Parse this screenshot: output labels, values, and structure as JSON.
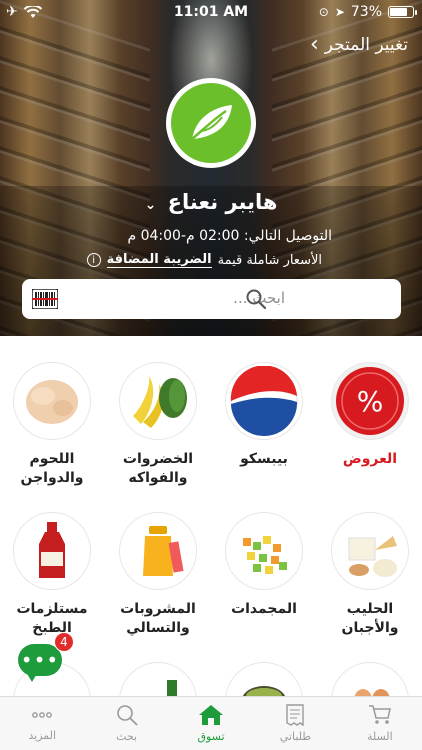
{
  "status_bar": {
    "time": "11:01 AM",
    "battery": "73%"
  },
  "header": {
    "change_store": "تغيير المتجر",
    "store_name": "هايبر نعناع",
    "delivery": "التوصيل التالي: 02:00 م-04:00 م",
    "vat_prefix": "الأسعار شاملة قيمة",
    "vat_link": "الضريبة المضافة"
  },
  "search": {
    "placeholder": "ابحث ..."
  },
  "categories": [
    {
      "label": "العروض"
    },
    {
      "label": "بيبسكو"
    },
    {
      "label": "الخضروات والفواكه"
    },
    {
      "label": "اللحوم والدواجن"
    },
    {
      "label": "الحليب والأجبان"
    },
    {
      "label": "المجمدات"
    },
    {
      "label": "المشروبات والتسالي"
    },
    {
      "label": "مستلزمات الطبخ"
    }
  ],
  "chat": {
    "badge": "4"
  },
  "tabbar": [
    {
      "label": "السلة",
      "icon": "cart-icon"
    },
    {
      "label": "طلباتي",
      "icon": "receipt-icon"
    },
    {
      "label": "تسوق",
      "icon": "home-icon"
    },
    {
      "label": "بحث",
      "icon": "search-icon"
    },
    {
      "label": "المزيد",
      "icon": "more-icon"
    }
  ],
  "colors": {
    "brand_green": "#1e9b3a",
    "offers_red": "#d71920",
    "logo_green": "#6bbf2b"
  }
}
